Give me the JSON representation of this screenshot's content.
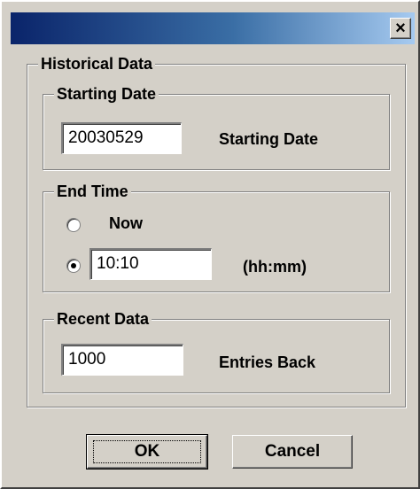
{
  "dialog": {
    "title": "",
    "close_glyph": "×"
  },
  "historical_data": {
    "legend": "Historical Data",
    "starting_date": {
      "legend": "Starting Date",
      "value": "20030529",
      "label": "Starting Date"
    },
    "end_time": {
      "legend": "End Time",
      "now_label": "Now",
      "now_selected": false,
      "time_selected": true,
      "time_value": "10:10",
      "format_label": "(hh:mm)"
    },
    "recent_data": {
      "legend": "Recent Data",
      "value": "1000",
      "label": "Entries Back"
    }
  },
  "buttons": {
    "ok_label": "OK",
    "cancel_label": "Cancel"
  },
  "colors": {
    "dialog_face": "#d4d0c8",
    "title_gradient_start": "#0a246a",
    "title_gradient_end": "#a6caf0"
  }
}
